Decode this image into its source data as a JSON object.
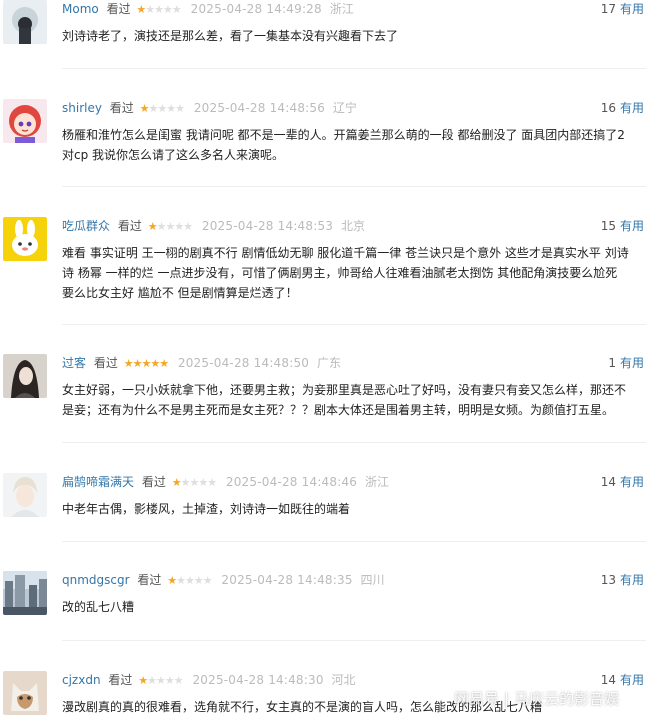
{
  "reviews": [
    {
      "user": "Momo",
      "seen": "看过",
      "rating": 1,
      "time": "2025-04-28 14:49:28",
      "location": "浙江",
      "votes": "17",
      "useful": "有用",
      "lines": [
        "刘诗诗老了，演技还是那么差，看了一集基本没有兴趣看下去了"
      ]
    },
    {
      "user": "shirley",
      "seen": "看过",
      "rating": 1,
      "time": "2025-04-28 14:48:56",
      "location": "辽宁",
      "votes": "16",
      "useful": "有用",
      "lines": [
        "杨雁和淮竹怎么是闺蜜 我请问呢 都不是一辈的人。开篇姜兰那么萌的一段 都给删没了 面具团内部还搞了2",
        "对cp 我说你怎么请了这么多名人来演呢。"
      ]
    },
    {
      "user": "吃瓜群众",
      "seen": "看过",
      "rating": 1,
      "time": "2025-04-28 14:48:53",
      "location": "北京",
      "votes": "15",
      "useful": "有用",
      "lines": [
        "难看 事实证明 王一栩的剧真不行 剧情低幼无聊 服化道千篇一律 苍兰诀只是个意外 这些才是真实水平 刘诗",
        "诗 杨幂 一样的烂 一点进步没有，可惜了俩剧男主，帅哥给人往难看油腻老太捯饬 其他配角演技要么尬死",
        "要么比女主好 尴尬不 但是剧情算是烂透了！"
      ]
    },
    {
      "user": "过客",
      "seen": "看过",
      "rating": 5,
      "time": "2025-04-28 14:48:50",
      "location": "广东",
      "votes": "1",
      "useful": "有用",
      "lines": [
        "女主好弱，一只小妖就拿下他，还要男主救；为妾那里真是恶心吐了好吗，没有妻只有妾又怎么样，那还不",
        "是妾；还有为什么不是男主死而是女主死？？？剧本大体还是围着男主转，明明是女频。为颜值打五星。"
      ]
    },
    {
      "user": "扁鹄啼霜满天",
      "seen": "看过",
      "rating": 1,
      "time": "2025-04-28 14:48:46",
      "location": "浙江",
      "votes": "14",
      "useful": "有用",
      "lines": [
        "中老年古偶，影楼风，土掉渣，刘诗诗一如既往的端着"
      ]
    },
    {
      "user": "qnmdgscgr",
      "seen": "看过",
      "rating": 1,
      "time": "2025-04-28 14:48:35",
      "location": "四川",
      "votes": "13",
      "useful": "有用",
      "lines": [
        "改的乱七八糟"
      ]
    },
    {
      "user": "cjzxdn",
      "seen": "看过",
      "rating": 1,
      "time": "2025-04-28 14:48:30",
      "location": "河北",
      "votes": "14",
      "useful": "有用",
      "lines": [
        "漫改剧真的真的很难看，选角就不行，女主真的不是演的盲人吗，怎么能改的那么乱七八糟"
      ]
    }
  ],
  "watermark": {
    "platform": "网易号",
    "separator": "|",
    "author": "马庆云的影音娱"
  },
  "colors": {
    "username": "#3377aa",
    "star_on": "#f5a623",
    "star_off": "#dedede",
    "meta": "#bbbbbb"
  }
}
